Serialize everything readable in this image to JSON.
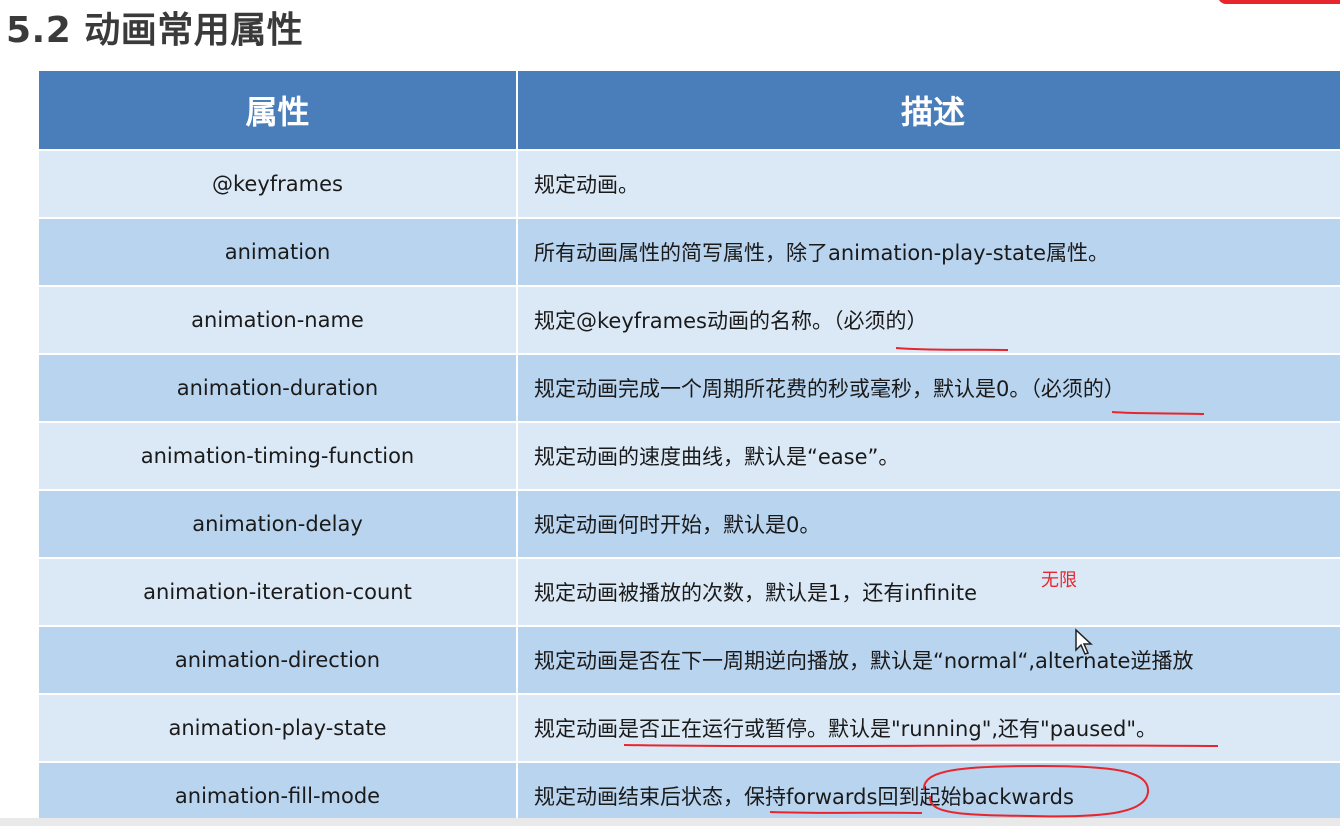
{
  "title": "5.2 动画常用属性",
  "table": {
    "headers": [
      "属性",
      "描述"
    ],
    "rows": [
      {
        "property": "@keyframes",
        "description": "规定动画。"
      },
      {
        "property": "animation",
        "description": "所有动画属性的简写属性，除了animation-play-state属性。"
      },
      {
        "property": "animation-name",
        "description": "规定@keyframes动画的名称。（必须的）"
      },
      {
        "property": "animation-duration",
        "description": "规定动画完成一个周期所花费的秒或毫秒，默认是0。（必须的）"
      },
      {
        "property": "animation-timing-function",
        "description": "规定动画的速度曲线，默认是“ease”。"
      },
      {
        "property": "animation-delay",
        "description": "规定动画何时开始，默认是0。"
      },
      {
        "property": "animation-iteration-count",
        "description": "规定动画被播放的次数，默认是1，还有infinite"
      },
      {
        "property": "animation-direction",
        "description": "规定动画是否在下一周期逆向播放，默认是“normal“,alternate逆播放"
      },
      {
        "property": "animation-play-state",
        "description": "规定动画是否正在运行或暂停。默认是\"running\",还有\"paused\"。"
      },
      {
        "property": "animation-fill-mode",
        "description": "规定动画结束后状态，保持forwards回到起始backwards"
      }
    ]
  },
  "annotation_note": "无限",
  "colors": {
    "header_bg": "#4a7ebb",
    "row_light": "#dbe9f7",
    "row_dark": "#b9d4ef",
    "annotation_red": "#e8252c"
  }
}
